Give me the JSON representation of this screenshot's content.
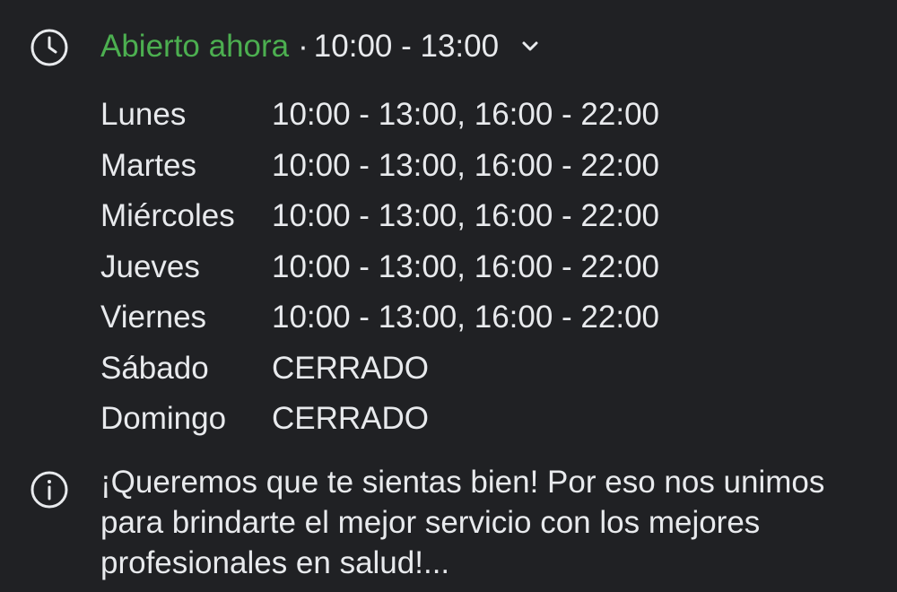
{
  "status": {
    "open_label": "Abierto ahora",
    "separator": "·",
    "current_hours": "10:00 - 13:00"
  },
  "schedule": [
    {
      "day": "Lunes",
      "hours": "10:00 - 13:00, 16:00 - 22:00"
    },
    {
      "day": "Martes",
      "hours": "10:00 - 13:00, 16:00 - 22:00"
    },
    {
      "day": "Miércoles",
      "hours": "10:00 - 13:00, 16:00 - 22:00"
    },
    {
      "day": "Jueves",
      "hours": "10:00 - 13:00, 16:00 - 22:00"
    },
    {
      "day": "Viernes",
      "hours": "10:00 - 13:00, 16:00 - 22:00"
    },
    {
      "day": "Sábado",
      "hours": "CERRADO"
    },
    {
      "day": "Domingo",
      "hours": "CERRADO"
    }
  ],
  "description": "¡Queremos que te sientas bien! Por eso nos unimos para brindarte el mejor servicio con los mejores profesionales en salud!...",
  "icons": {
    "clock": "clock-icon",
    "chevron": "chevron-down-icon",
    "info": "info-icon"
  },
  "colors": {
    "background": "#202124",
    "text": "#e8eaed",
    "open_status": "#4caf50"
  }
}
